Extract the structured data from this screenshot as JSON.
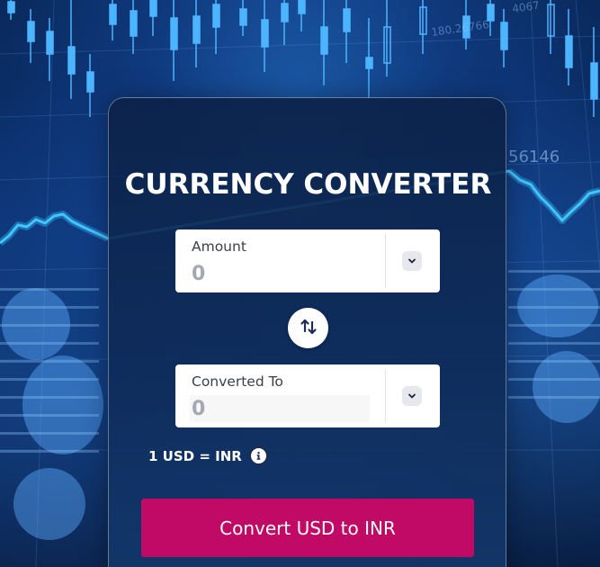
{
  "converter": {
    "title": "CURRENCY CONVERTER",
    "amount": {
      "label": "Amount",
      "placeholder": "0",
      "from_currency": "USD"
    },
    "converted": {
      "label": "Converted To",
      "placeholder": "0",
      "to_currency": "INR"
    },
    "rate_text": "1 USD = INR",
    "convert_button_label": "Convert USD to INR"
  },
  "background": {
    "figures": [
      "56146",
      "180.26766",
      "4067"
    ]
  },
  "colors": {
    "accent": "#c10a66",
    "card_background": "#0e2a56",
    "chart_line": "#3fc6ff",
    "text_muted": "#a3a8b3"
  },
  "icons": {
    "swap": "swap-vertical-icon",
    "dropdown": "chevron-down-icon",
    "info": "info-icon"
  }
}
